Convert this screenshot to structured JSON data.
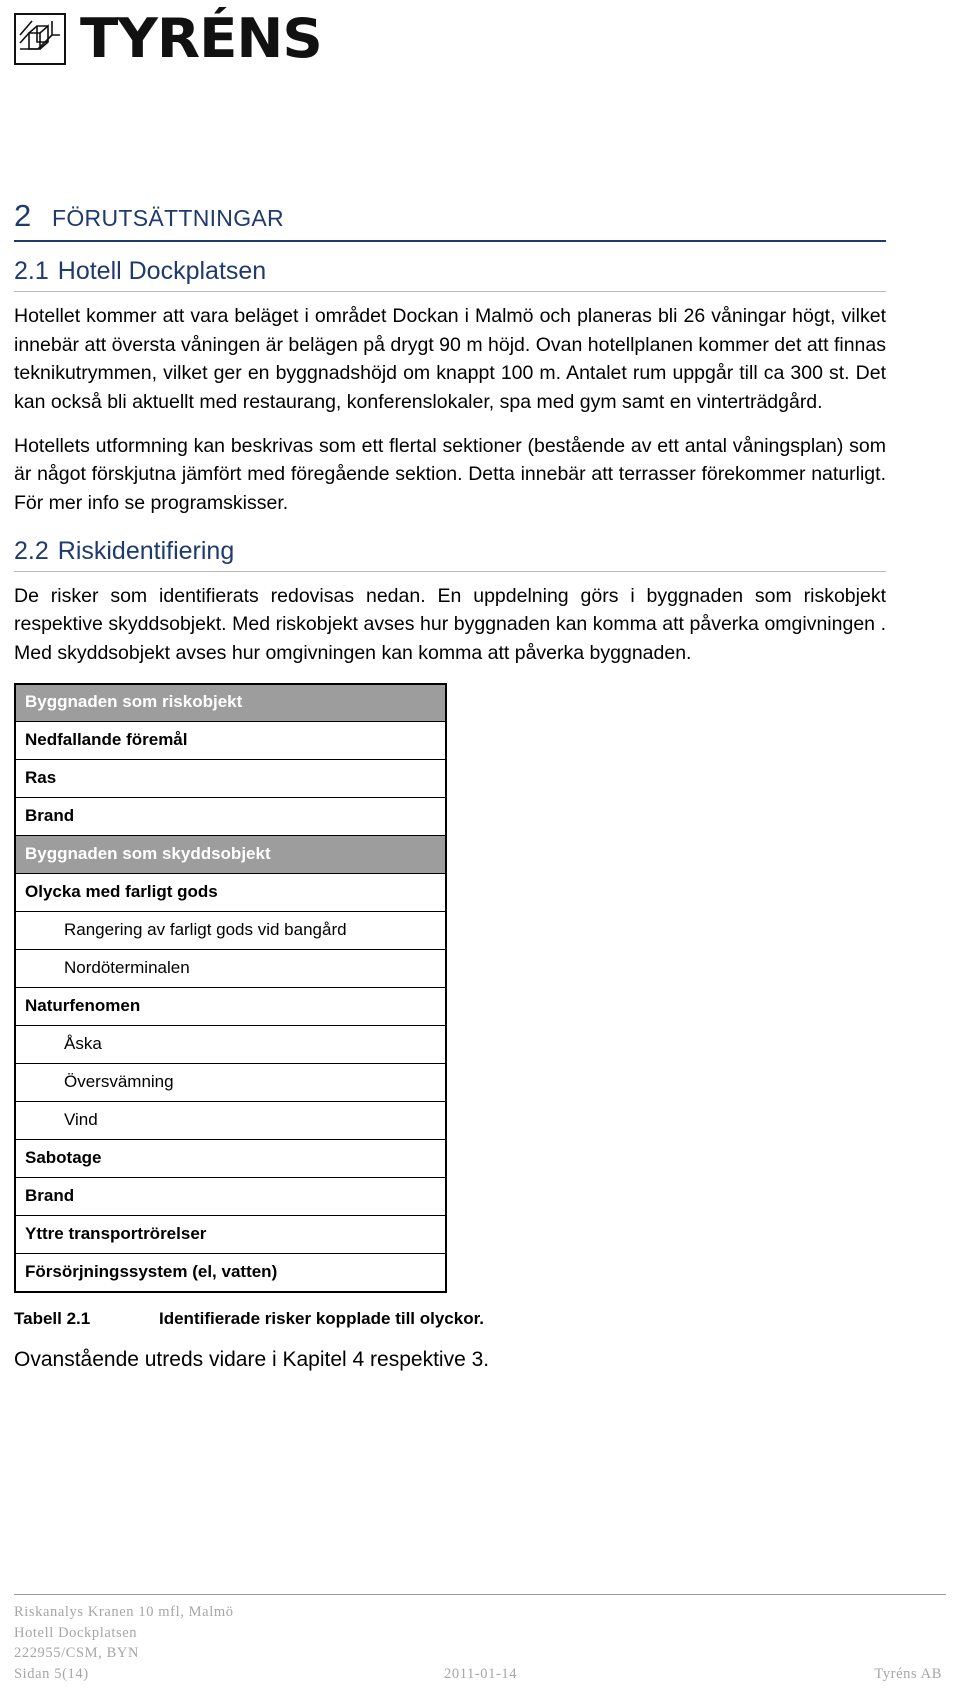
{
  "brand": {
    "wordmark": "TYRÉNS",
    "logo_icon": "tyrens-cube-logo"
  },
  "sections": {
    "h1": {
      "number": "2",
      "title": "Förutsättningar"
    },
    "h2_1": {
      "number": "2.1",
      "title": "Hotell Dockplatsen"
    },
    "h2_2": {
      "number": "2.2",
      "title": "Riskidentifiering"
    }
  },
  "paragraphs": {
    "p1": "Hotellet kommer att vara beläget i området Dockan i Malmö och planeras bli 26 våningar högt, vilket innebär att översta våningen är belägen på drygt 90 m höjd. Ovan hotellplanen kommer det att finnas teknikutrymmen, vilket ger en byggnadshöjd om knappt 100 m. Antalet rum uppgår till ca 300 st. Det kan också bli aktuellt med restaurang, konferenslokaler, spa med gym samt en vinterträdgård.",
    "p2": "Hotellets utformning kan beskrivas som ett flertal sektioner (bestående av ett antal våningsplan) som är något förskjutna jämfört med föregående sektion. Detta innebär att terrasser förekommer naturligt. För mer info se programskisser.",
    "p3": "De risker som identifierats redovisas nedan. En uppdelning görs i byggnaden som riskobjekt respektive skyddsobjekt. Med riskobjekt avses hur byggnaden kan komma att påverka omgivningen . Med skyddsobjekt avses hur omgivningen kan komma att påverka byggnaden.",
    "after_table": "Ovanstående utreds vidare i Kapitel 4 respektive 3."
  },
  "table": {
    "rows": [
      {
        "type": "header",
        "label": "Byggnaden som riskobjekt"
      },
      {
        "type": "category",
        "label": "Nedfallande föremål"
      },
      {
        "type": "category",
        "label": "Ras"
      },
      {
        "type": "category",
        "label": "Brand"
      },
      {
        "type": "header",
        "label": "Byggnaden som skyddsobjekt"
      },
      {
        "type": "category",
        "label": "Olycka med farligt gods"
      },
      {
        "type": "sub",
        "label": "Rangering av farligt gods vid bangård"
      },
      {
        "type": "sub",
        "label": "Nordöterminalen"
      },
      {
        "type": "category",
        "label": "Naturfenomen"
      },
      {
        "type": "sub",
        "label": "Åska"
      },
      {
        "type": "sub",
        "label": "Översvämning"
      },
      {
        "type": "sub",
        "label": "Vind"
      },
      {
        "type": "category",
        "label": "Sabotage"
      },
      {
        "type": "category",
        "label": "Brand"
      },
      {
        "type": "category",
        "label": "Yttre transportrörelser"
      },
      {
        "type": "category",
        "label": "Försörjningssystem (el, vatten)"
      }
    ],
    "caption_label": "Tabell 2.1",
    "caption_text": "Identifierade risker kopplade till olyckor."
  },
  "footer": {
    "line1": "Riskanalys Kranen 10 mfl, Malmö",
    "line2": "Hotell Dockplatsen",
    "line3": "222955/CSM, BYN",
    "page": "Sidan 5(14)",
    "date": "2011-01-14",
    "company": "Tyréns AB"
  },
  "colors": {
    "heading_blue": "#1f3a6e",
    "table_header_gray": "#9d9d9d",
    "footer_gray": "#a6a6a6"
  }
}
